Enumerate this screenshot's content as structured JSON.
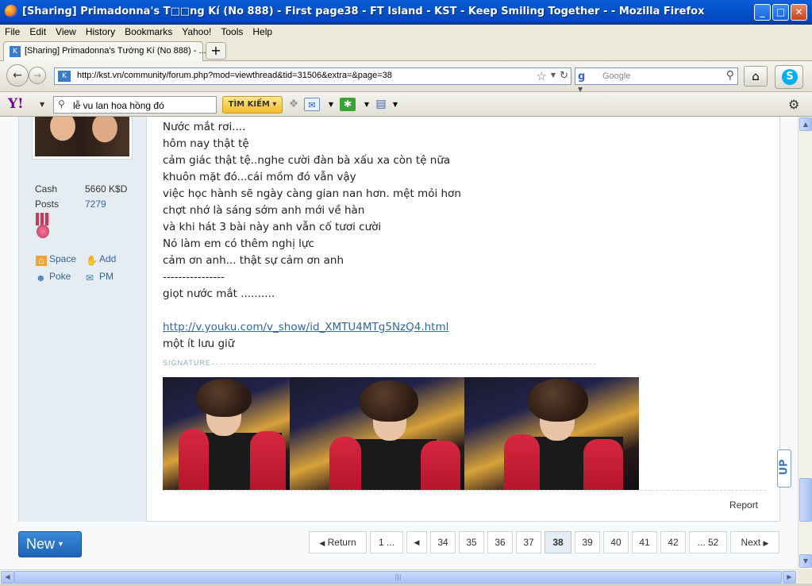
{
  "window": {
    "title": "[Sharing] Primadonna's T□□ng Kí (No 888) - First page38 - FT Island - KST - Keep Smiling Together - - Mozilla Firefox",
    "minimize_label": "_",
    "maximize_label": "□",
    "close_label": "✕"
  },
  "menu": {
    "items": [
      "File",
      "Edit",
      "View",
      "History",
      "Bookmarks",
      "Yahoo!",
      "Tools",
      "Help"
    ]
  },
  "tabs": {
    "active_label": "[Sharing] Primadonna's Tướng Kí (No 888) - ...",
    "new_tab_label": "+"
  },
  "nav": {
    "url": "http://kst.vn/community/forum.php?mod=viewthread&tid=31506&extra=&page=38",
    "search_placeholder": "Google",
    "search_engine_icon": "google-icon"
  },
  "yahoo": {
    "logo": "Y!",
    "search_value": "lễ vu lan hoa hồng đó",
    "search_button": "TÌM KIẾM"
  },
  "user": {
    "stats": [
      {
        "label": "Cash",
        "value": "5660 K$D"
      },
      {
        "label": "Posts",
        "value": "7279"
      }
    ],
    "links": {
      "space": "Space",
      "add": "Add",
      "poke": "Poke",
      "pm": "PM"
    }
  },
  "post": {
    "lines": [
      "Nước mắt rơi....",
      "hôm nay thật tệ",
      "cảm giác thật tệ..nghe cười đàn bà xấu xa còn tệ nữa",
      "khuôn mặt đó...cái mồm đó vẫn vậy",
      "việc học hành sẽ ngày càng gian nan hơn. mệt mỏi hơn",
      "chợt nhớ là sáng sớm anh mới về hàn",
      "và khi hát 3 bài này anh vẫn cố tươi cười",
      "Nó làm em có thêm nghị lực",
      "cảm ơn anh... thật sự cảm ơn anh",
      "----------------",
      "giọt nước mắt .........."
    ],
    "link": "http://v.youku.com/v_show/id_XMTU4MTg5NzQ4.html",
    "after_link": "một ít lưu giữ",
    "signature_label": "SIGNATURE",
    "report_label": "Report"
  },
  "pagination": {
    "new_button": "New",
    "return_label": "Return",
    "first_label": "1 ...",
    "pages": [
      "34",
      "35",
      "36",
      "37",
      "38",
      "39",
      "40",
      "41",
      "42"
    ],
    "current_page": "38",
    "last_label": "... 52",
    "next_label": "Next"
  },
  "up_button": "UP"
}
